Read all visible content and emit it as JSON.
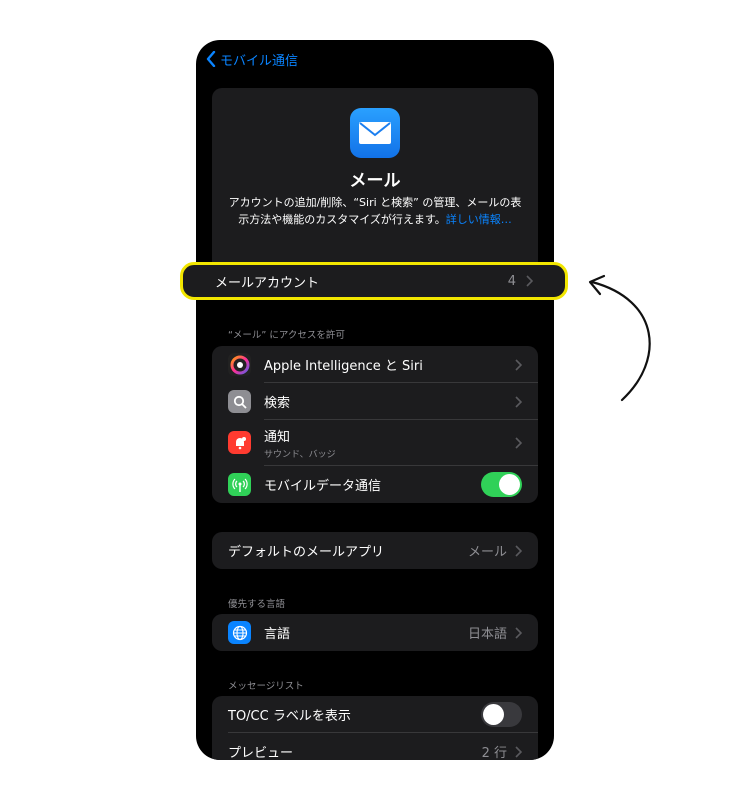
{
  "nav": {
    "back_label": "モバイル通信"
  },
  "header": {
    "app_name": "メール",
    "description": "アカウントの追加/削除、“Siri と検索” の管理、メールの表示方法や機能のカスタマイズが行えます。",
    "link": "詳しい情報…"
  },
  "accounts": {
    "label": "メールアカウント",
    "count": "4"
  },
  "access": {
    "header": "“メール” にアクセスを許可",
    "items": [
      {
        "label": "Apple Intelligence と Siri",
        "icon": "apple-intelligence-icon"
      },
      {
        "label": "検索",
        "icon": "search-icon"
      },
      {
        "label": "通知",
        "sublabel": "サウンド、バッジ",
        "icon": "notification-icon"
      },
      {
        "label": "モバイルデータ通信",
        "icon": "cellular-icon",
        "toggle": true
      }
    ]
  },
  "default_app": {
    "label": "デフォルトのメールアプリ",
    "value": "メール"
  },
  "language": {
    "header": "優先する言語",
    "label": "言語",
    "value": "日本語",
    "icon": "globe-icon"
  },
  "message_list": {
    "header": "メッセージリスト",
    "tocc_label": "TO/CC ラベルを表示",
    "tocc_toggle": false,
    "preview_label": "プレビュー",
    "preview_value": "2 行"
  },
  "colors": {
    "accent": "#0a84ff",
    "highlight": "#f2e600",
    "toggle_on": "#30d158"
  }
}
